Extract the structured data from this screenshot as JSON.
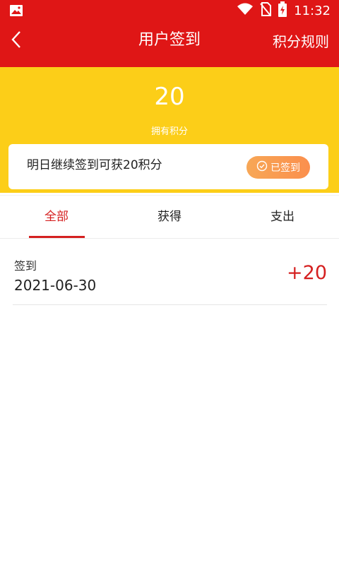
{
  "status_bar": {
    "time": "11:32",
    "icons": [
      "image-icon",
      "wifi-icon",
      "no-sim-icon",
      "battery-charging-icon"
    ]
  },
  "app_bar": {
    "back_icon": "chevron-left-icon",
    "title": "用户签到",
    "rules_link": "积分规则"
  },
  "points": {
    "value": "20",
    "label": "拥有积分"
  },
  "checkin": {
    "message": "明日继续签到可获20积分",
    "button_label": "已签到",
    "button_icon": "check-circle-icon"
  },
  "tabs": {
    "all": "全部",
    "earned": "获得",
    "spent": "支出",
    "active": "全部"
  },
  "records": [
    {
      "title": "签到",
      "date": "2021-06-30",
      "amount": "+20"
    }
  ],
  "colors": {
    "header_red": "#df1616",
    "panel_yellow": "#fcce18",
    "accent_red": "#d52020",
    "button_orange": "#fb8f4d"
  }
}
